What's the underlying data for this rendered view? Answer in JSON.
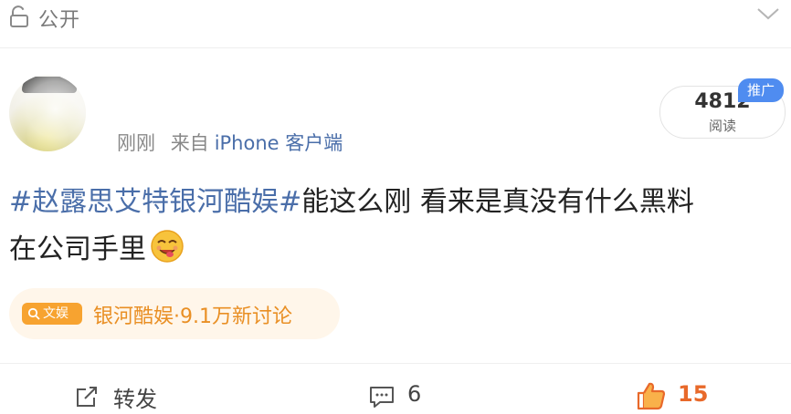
{
  "visibility": {
    "label": "公开",
    "icon": "lock-open-icon",
    "collapse_icon": "chevron-down-icon"
  },
  "post": {
    "timestamp": "刚刚",
    "source_prefix": "来自",
    "source_device": "iPhone 客户端",
    "topic": "#赵露思艾特银河酷娱#",
    "text_line1": "能这么刚 看来是真没有什么黑料",
    "text_line2": "在公司手里",
    "emoji": "yum-face-icon"
  },
  "read_stats": {
    "count": "4812",
    "label": "阅读",
    "badge": "推广"
  },
  "topic_chip": {
    "tag": "文娱",
    "text": "银河酷娱·9.1万新讨论"
  },
  "actions": {
    "forward_label": "转发",
    "comment_count": "6",
    "like_count": "15"
  },
  "colors": {
    "link_blue": "#4a6ea9",
    "accent_orange": "#e8692a",
    "chip_bg": "#fff6ea",
    "chip_tag": "#f7a330",
    "badge_blue": "#4f8cf0"
  }
}
